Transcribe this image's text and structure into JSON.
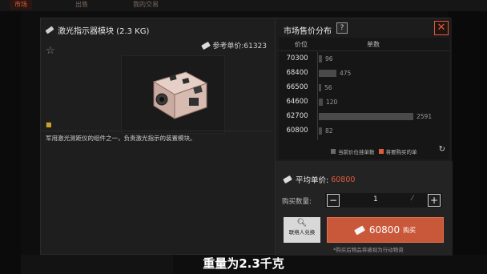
{
  "topbar": {
    "tabs": [
      {
        "label": "市场"
      },
      {
        "label": "出售"
      },
      {
        "label": "我的交易"
      }
    ]
  },
  "item": {
    "name": "激光指示器模块 (2.3 KG)",
    "ref_price_label": "参考单价:61323",
    "description": "军用激光测距仪的组件之一，负责激光指示的装置模块。",
    "icon": "laser-module-icon"
  },
  "market": {
    "title": "市场售价分布",
    "help": "?",
    "close": "✕",
    "col_price": "价位",
    "col_units": "单数",
    "rows": [
      {
        "price": "70300",
        "count": "96"
      },
      {
        "price": "68400",
        "count": "475"
      },
      {
        "price": "66500",
        "count": "56"
      },
      {
        "price": "64600",
        "count": "120"
      },
      {
        "price": "62700",
        "count": "2591"
      },
      {
        "price": "60800",
        "count": "82"
      }
    ],
    "legend_current": "当前价位挂单数",
    "legend_mine": "将要购买的单",
    "colors": {
      "bar": "#4a4a4a",
      "current": "#6a6a6a",
      "mine": "#e05a3c"
    }
  },
  "chart_data": {
    "type": "bar",
    "orientation": "horizontal",
    "categories": [
      "70300",
      "68400",
      "66500",
      "64600",
      "62700",
      "60800"
    ],
    "values": [
      96,
      475,
      56,
      120,
      2591,
      82
    ],
    "xlabel": "单数",
    "ylabel": "价位"
  },
  "purchase": {
    "avg_label": "平均单价:",
    "avg_value": "60800",
    "qty_label": "购买数量:",
    "qty_value": "1",
    "minus": "−",
    "plus": "+",
    "contact_label": "联络人兑换",
    "buy_price": "60800",
    "buy_label": "购买",
    "note": "*购买后物品将被视为行动物资"
  },
  "subtitle": "重量为2.3千克"
}
